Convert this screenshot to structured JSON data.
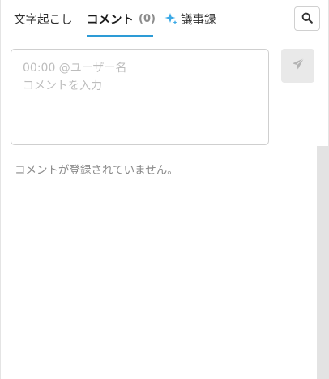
{
  "tabs": {
    "transcript_label": "文字起こし",
    "comments_label": "コメント",
    "comments_count": "(0)",
    "minutes_label": "議事録",
    "active": "comments"
  },
  "icons": {
    "search": "search-icon",
    "send": "send-icon",
    "sparkle": "sparkle-icon"
  },
  "colors": {
    "accent": "#2d9bd6",
    "sparkle": "#3aa9e6"
  },
  "comment_form": {
    "placeholder_line1": "00:00 @ユーザー名",
    "placeholder_line2": "コメントを入力",
    "value": ""
  },
  "comments": {
    "empty_message": "コメントが登録されていません。"
  }
}
